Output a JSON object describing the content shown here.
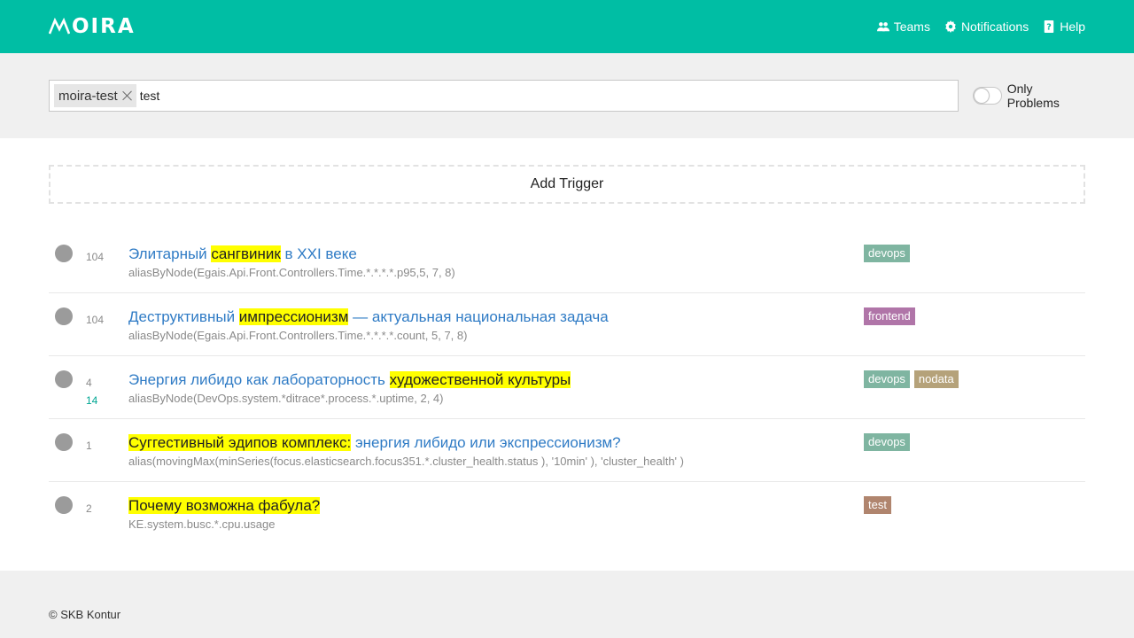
{
  "header": {
    "logo": "MOIRA",
    "nav": [
      {
        "label": "Teams",
        "icon": "users-icon"
      },
      {
        "label": "Notifications",
        "icon": "gear-icon"
      },
      {
        "label": "Help",
        "icon": "help-icon"
      }
    ]
  },
  "search": {
    "chip": "moira-test",
    "value": "test",
    "only_problems_label": "Only Problems"
  },
  "main": {
    "add_trigger_label": "Add Trigger"
  },
  "triggers": [
    {
      "count_main": "104",
      "count_ok": "",
      "title_parts": [
        "Элитарный ",
        "сангвиник",
        " в XXI веке"
      ],
      "target": "aliasByNode(Egais.Api.Front.Controllers.Time.*.*.*.*.p95,5, 7, 8)",
      "tags": [
        {
          "label": "devops",
          "color": "#7fb5a1"
        }
      ]
    },
    {
      "count_main": "104",
      "count_ok": "",
      "title_parts": [
        "Деструктивный ",
        "импрессионизм",
        " — актуальная национальная задача"
      ],
      "target": "aliasByNode(Egais.Api.Front.Controllers.Time.*.*.*.*.count, 5, 7, 8)",
      "tags": [
        {
          "label": "frontend",
          "color": "#b075a8"
        }
      ]
    },
    {
      "count_main": "4",
      "count_ok": "14",
      "title_parts": [
        "Энергия либидо как лабораторность ",
        "художественной культуры",
        ""
      ],
      "target": "aliasByNode(DevOps.system.*ditrace*.process.*.uptime, 2, 4)",
      "tags": [
        {
          "label": "devops",
          "color": "#7fb5a1"
        },
        {
          "label": "nodata",
          "color": "#b5a27a"
        }
      ]
    },
    {
      "count_main": "1",
      "count_ok": "",
      "title_parts": [
        "",
        "Суггестивный эдипов комплекс:",
        " энергия либидо или экспрессионизм?"
      ],
      "target": "alias(movingMax(minSeries(focus.elasticsearch.focus351.*.cluster_health.status ), '10min' ), 'cluster_health' )",
      "tags": [
        {
          "label": "devops",
          "color": "#7fb5a1"
        }
      ]
    },
    {
      "count_main": "2",
      "count_ok": "",
      "title_parts": [
        "",
        "Почему возможна фабула?",
        ""
      ],
      "target": "KE.system.busc.*.cpu.usage",
      "tags": [
        {
          "label": "test",
          "color": "#b0856e"
        }
      ]
    }
  ],
  "footer": {
    "copyright": "© SKB Kontur"
  },
  "colors": {
    "header_bg": "#00bea4",
    "link": "#2f7bc5",
    "highlight": "#ffff00",
    "status_dot": "#9b9b9b"
  }
}
